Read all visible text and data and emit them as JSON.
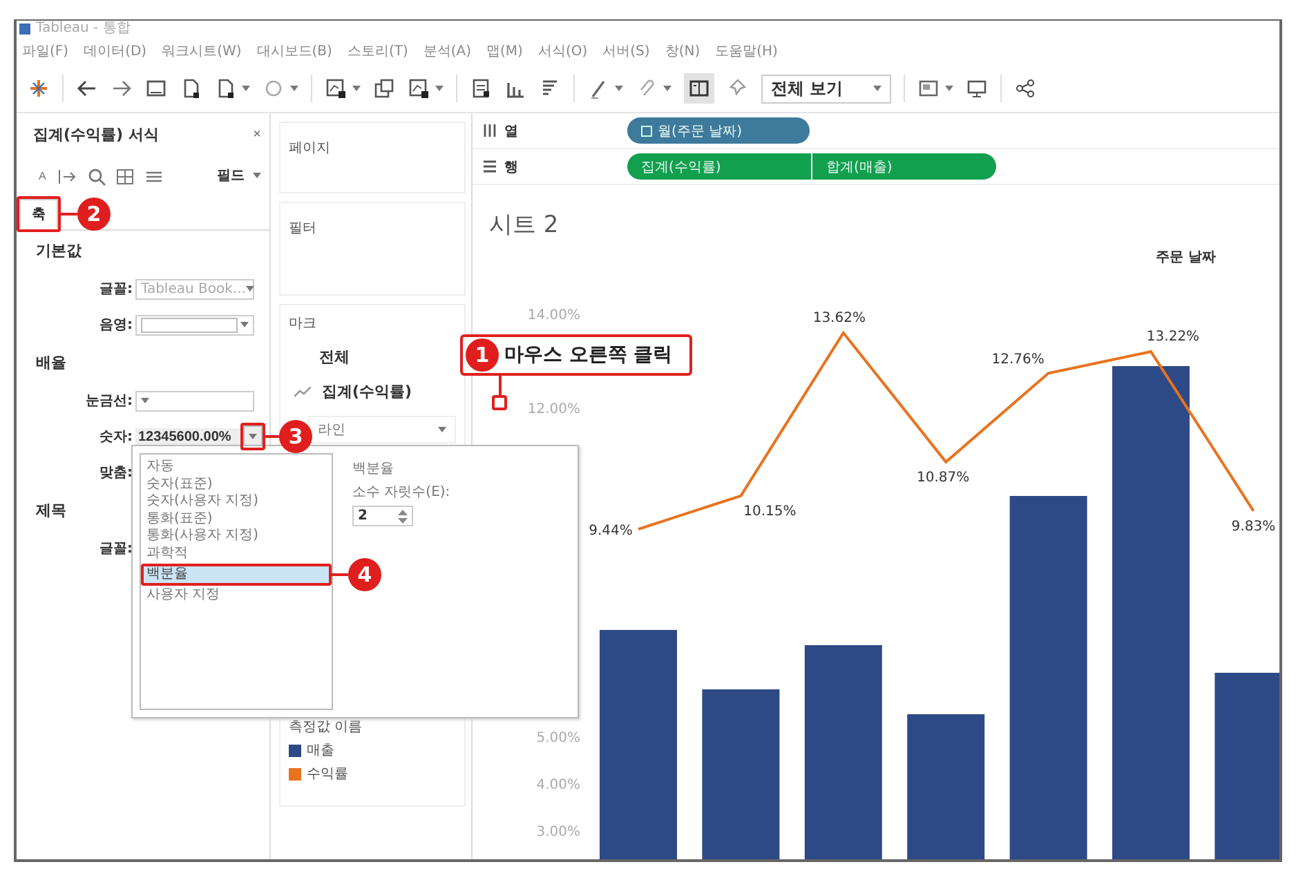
{
  "window": {
    "title": "Tableau - 통합"
  },
  "menu": [
    "파일(F)",
    "데이터(D)",
    "워크시트(W)",
    "대시보드(B)",
    "스토리(T)",
    "분석(A)",
    "맵(M)",
    "서식(O)",
    "서버(S)",
    "창(N)",
    "도움말(H)"
  ],
  "toolbar": {
    "view_dropdown": "전체 보기"
  },
  "format_pane": {
    "title": "집계(수익률) 서식",
    "close": "×",
    "font_tool": "A",
    "fields_button": "필드",
    "tabs": [
      {
        "label": "축",
        "selected": true
      }
    ],
    "sections": [
      {
        "title": "기본값",
        "rows": [
          {
            "label": "글꼴:",
            "kind": "dropdown",
            "value": "Tableau Book..."
          },
          {
            "label": "음영:",
            "kind": "color"
          }
        ]
      },
      {
        "title": "배율",
        "rows": [
          {
            "label": "눈금선:",
            "kind": "dropdown"
          },
          {
            "label": "숫자:",
            "kind": "number",
            "value": "12345600.00%"
          },
          {
            "label": "맞춤:",
            "kind": "label"
          }
        ]
      },
      {
        "title": "제목",
        "rows": [
          {
            "label": "글꼴:",
            "kind": "label"
          }
        ]
      }
    ]
  },
  "shelves_pane": {
    "pages": "페이지",
    "filters": "필터",
    "marks": {
      "title": "마크",
      "all": "전체",
      "measure": "집계(수익률)",
      "mark_type": "라인"
    },
    "legend": {
      "title": "측정값 이름",
      "items": [
        {
          "label": "매출",
          "color": "#2e4a86"
        },
        {
          "label": "수익률",
          "color": "#e8731f"
        }
      ]
    }
  },
  "columns_shelf": {
    "label": "열",
    "pills": [
      {
        "label": "월(주문 날짜)",
        "kind": "date"
      }
    ]
  },
  "rows_shelf": {
    "label": "행",
    "pills": [
      {
        "label": "집계(수익률)",
        "kind": "measure"
      },
      {
        "label": "합계(매출)",
        "kind": "measure"
      }
    ]
  },
  "sheet": {
    "title": "시트 2",
    "header": "주문 날짜",
    "chart_data": {
      "type": "line",
      "ylim": [
        3,
        14
      ],
      "yticks": [
        {
          "value": 3,
          "label": "3.00%"
        },
        {
          "value": 4,
          "label": "4.00%"
        },
        {
          "value": 5,
          "label": "5.00%"
        },
        {
          "value": 12,
          "label": "12.00%"
        },
        {
          "value": 14,
          "label": "14.00%"
        }
      ],
      "series": [
        {
          "color": "#e8731f",
          "values": [
            9.44,
            10.15,
            13.62,
            10.87,
            12.76,
            13.22,
            9.83
          ]
        }
      ],
      "value_labels": [
        "9.44%",
        "10.15%",
        "13.62%",
        "10.87%",
        "12.76%",
        "13.22%",
        "9.83%"
      ]
    }
  },
  "number_format_popup": {
    "options": [
      {
        "label": "자동",
        "selected": false
      },
      {
        "label": "숫자(표준)",
        "selected": false
      },
      {
        "label": "숫자(사용자 지정)",
        "selected": false
      },
      {
        "label": "통화(표준)",
        "selected": false
      },
      {
        "label": "통화(사용자 지정)",
        "selected": false
      },
      {
        "label": "과학적",
        "selected": false
      },
      {
        "label": "백분율",
        "selected": true
      },
      {
        "label": "사용자 지정",
        "selected": false
      }
    ],
    "detail_title": "백분율",
    "decimal_label": "소수 자릿수(E):",
    "decimal_value": "2"
  },
  "annotations": [
    {
      "number": "1",
      "text": "마우스 오른쪽 클릭"
    },
    {
      "number": "2"
    },
    {
      "number": "3"
    },
    {
      "number": "4"
    }
  ]
}
